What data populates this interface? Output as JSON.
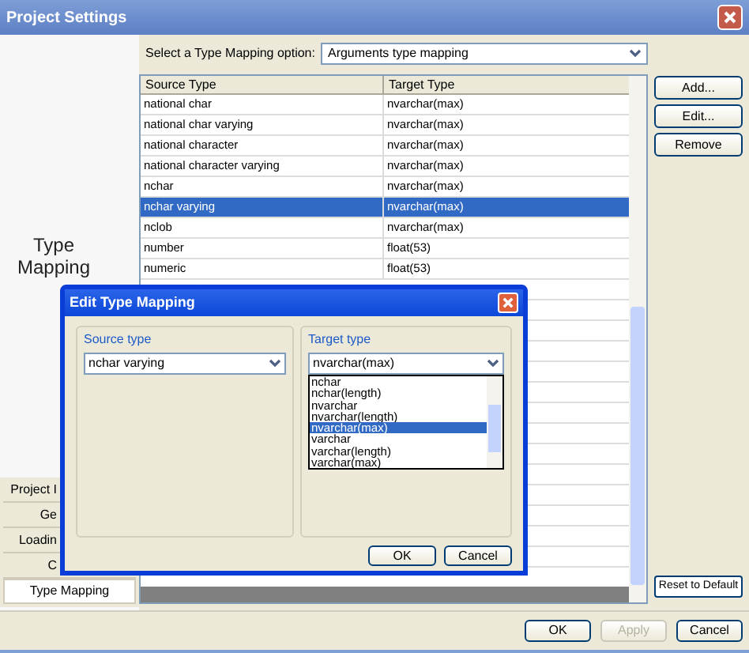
{
  "window": {
    "title": "Project Settings"
  },
  "sidebar": {
    "heading": "Type Mapping",
    "tabs": [
      {
        "label": "Project I",
        "selected": false
      },
      {
        "label": "Ge",
        "selected": false
      },
      {
        "label": "Loadin",
        "selected": false
      },
      {
        "label": "C",
        "selected": false
      },
      {
        "label": "Type Mapping",
        "selected": true
      }
    ]
  },
  "option": {
    "label": "Select a Type Mapping option:",
    "value": "Arguments type mapping"
  },
  "table": {
    "columns": [
      "Source Type",
      "Target Type"
    ],
    "rows": [
      {
        "source": "national char",
        "target": "nvarchar(max)",
        "selected": false
      },
      {
        "source": "national char varying",
        "target": "nvarchar(max)",
        "selected": false
      },
      {
        "source": "national character",
        "target": "nvarchar(max)",
        "selected": false
      },
      {
        "source": "national character varying",
        "target": "nvarchar(max)",
        "selected": false
      },
      {
        "source": "nchar",
        "target": "nvarchar(max)",
        "selected": false
      },
      {
        "source": "nchar varying",
        "target": "nvarchar(max)",
        "selected": true
      },
      {
        "source": "nclob",
        "target": "nvarchar(max)",
        "selected": false
      },
      {
        "source": "number",
        "target": "float(53)",
        "selected": false
      },
      {
        "source": "numeric",
        "target": "float(53)",
        "selected": false
      }
    ]
  },
  "side_buttons": [
    "Add...",
    "Edit...",
    "Remove"
  ],
  "reset_button": "Reset to Default",
  "footer_buttons": [
    {
      "label": "OK",
      "disabled": false
    },
    {
      "label": "Apply",
      "disabled": true
    },
    {
      "label": "Cancel",
      "disabled": false
    }
  ],
  "dialog": {
    "title": "Edit Type Mapping",
    "source": {
      "label": "Source type",
      "value": "nchar varying"
    },
    "target": {
      "label": "Target type",
      "value": "nvarchar(max)",
      "options": [
        {
          "label": "nchar",
          "selected": false
        },
        {
          "label": "nchar(length)",
          "selected": false
        },
        {
          "label": "nvarchar",
          "selected": false
        },
        {
          "label": "nvarchar(length)",
          "selected": false
        },
        {
          "label": "nvarchar(max)",
          "selected": true
        },
        {
          "label": "varchar",
          "selected": false
        },
        {
          "label": "varchar(length)",
          "selected": false
        },
        {
          "label": "varchar(max)",
          "selected": false
        }
      ]
    },
    "buttons": [
      "OK",
      "Cancel"
    ]
  }
}
